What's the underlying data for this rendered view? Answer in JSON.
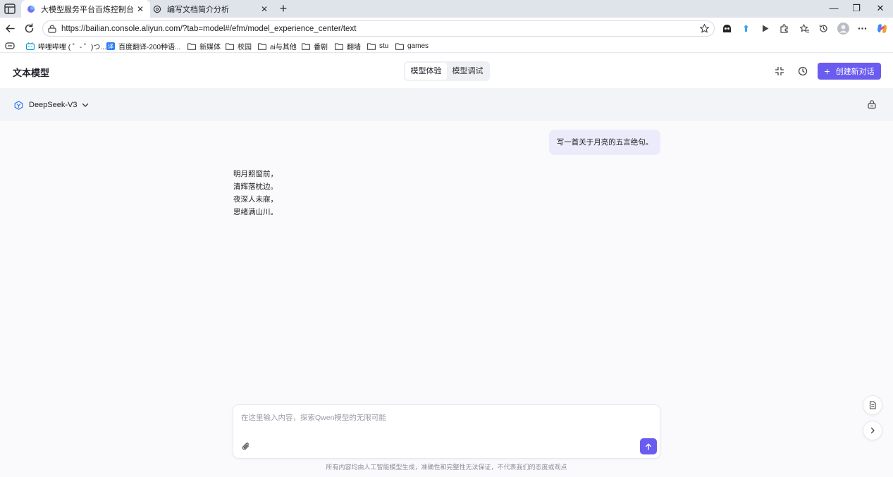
{
  "browser": {
    "tabs": [
      {
        "title": "大模型服务平台百炼控制台",
        "active": true
      },
      {
        "title": "编写文档简介分析",
        "active": false
      }
    ],
    "tab_close_glyph": "✕",
    "new_tab_glyph": "+",
    "window_controls": {
      "minimize": "—",
      "restore": "❐",
      "close": "✕"
    },
    "url": "https://bailian.console.aliyun.com/?tab=model#/efm/model_experience_center/text",
    "bookmarks": [
      {
        "label": "哔哩哔哩 ( ゜- ゜)つ...",
        "icon": "bilibili-icon"
      },
      {
        "label": "百度翻译-200种语...",
        "icon": "baidu-translate-icon"
      },
      {
        "label": "新媒体",
        "icon": "folder-icon"
      },
      {
        "label": "校园",
        "icon": "folder-icon"
      },
      {
        "label": "ai与其他",
        "icon": "folder-icon"
      },
      {
        "label": "番剧",
        "icon": "folder-icon"
      },
      {
        "label": "翻墙",
        "icon": "folder-icon"
      },
      {
        "label": "stu",
        "icon": "folder-icon"
      },
      {
        "label": "games",
        "icon": "folder-icon"
      }
    ]
  },
  "app": {
    "title": "文本模型",
    "mode_tabs": [
      {
        "label": "模型体验",
        "active": true
      },
      {
        "label": "模型调试",
        "active": false
      }
    ],
    "new_chat_plus": "+",
    "new_chat_label": "创建新对话",
    "model_name": "DeepSeek-V3",
    "accent_color": "#6b5cf0"
  },
  "conversation": {
    "user_message": "写一首关于月亮的五言绝句。",
    "assistant_lines": [
      "明月照窗前，",
      "清辉落枕边。",
      "夜深人未寐，",
      "思绪满山川。"
    ]
  },
  "composer": {
    "value": "",
    "placeholder": "在这里输入内容，探索Qwen模型的无限可能"
  },
  "disclaimer": "所有内容均由人工智能模型生成，准确性和完整性无法保证，不代表我们的态度或观点"
}
